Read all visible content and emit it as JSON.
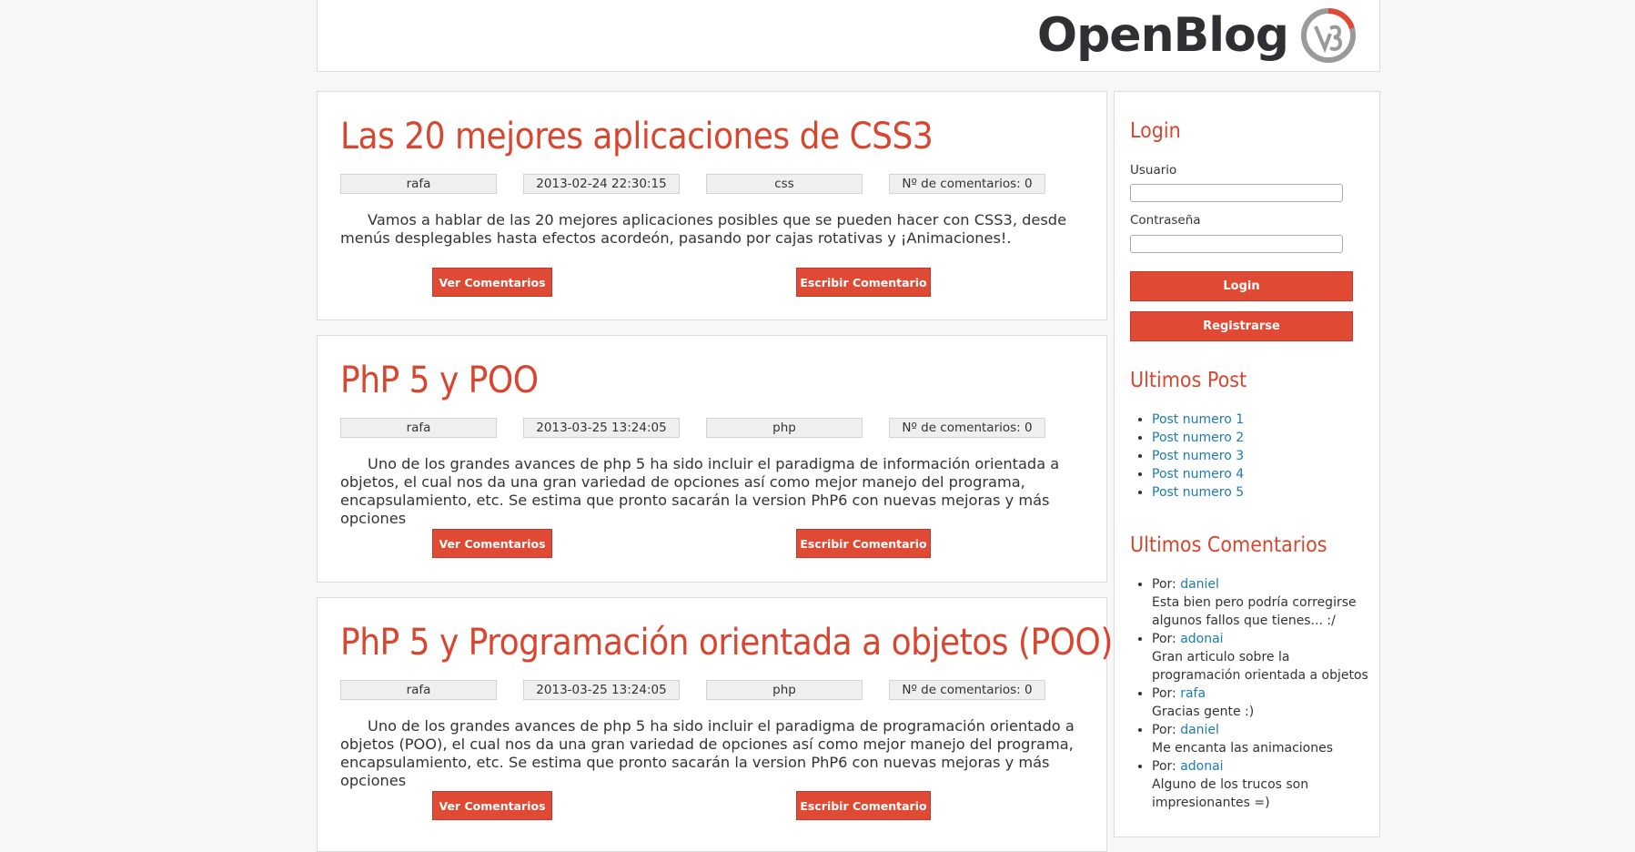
{
  "brand": {
    "name": "OpenBlog",
    "logo_icon": "v3-circle-logo"
  },
  "posts": [
    {
      "title": "Las 20 mejores aplicaciones de CSS3",
      "author": "rafa",
      "date": "2013-02-24 22:30:15",
      "category": "css",
      "comments": "Nº de comentarios: 0",
      "body": "Vamos a hablar de las 20 mejores aplicaciones posibles que se pueden hacer con CSS3, desde menús desplegables hasta efectos acordeón, pasando por cajas rotativas y ¡Animaciones!.",
      "view_label": "Ver Comentarios",
      "write_label": "Escribir Comentario"
    },
    {
      "title": "PhP 5 y POO",
      "author": "rafa",
      "date": "2013-03-25 13:24:05",
      "category": "php",
      "comments": "Nº de comentarios: 0",
      "body": "Uno de los grandes avances de php 5 ha sido incluir el paradigma de información orientada a objetos, el cual nos da una gran variedad de opciones así como mejor manejo del programa, encapsulamiento, etc. Se estima que pronto sacarán la version PhP6 con nuevas mejoras y más opciones",
      "view_label": "Ver Comentarios",
      "write_label": "Escribir Comentario"
    },
    {
      "title": "PhP 5 y Programación orientada a objetos (POO)",
      "author": "rafa",
      "date": "2013-03-25 13:24:05",
      "category": "php",
      "comments": "Nº de comentarios: 0",
      "body": "Uno de los grandes avances de php 5 ha sido incluir el paradigma de programación orientado a objetos (POO), el cual nos da una gran variedad de opciones así como mejor manejo del programa, encapsulamiento, etc. Se estima que pronto sacarán la version PhP6 con nuevas mejoras y más opciones",
      "view_label": "Ver Comentarios",
      "write_label": "Escribir Comentario"
    }
  ],
  "sidebar": {
    "login": {
      "title": "Login",
      "user_label": "Usuario",
      "user_value": "",
      "pass_label": "Contraseña",
      "pass_value": "",
      "login_button": "Login",
      "register_button": "Registrarse"
    },
    "latest_posts": {
      "title": "Ultimos Post",
      "items": [
        "Post numero 1",
        "Post numero 2",
        "Post numero 3",
        "Post numero 4",
        "Post numero 5"
      ]
    },
    "latest_comments": {
      "title": "Ultimos Comentarios",
      "prefix": "Por: ",
      "items": [
        {
          "user": "daniel",
          "text": "Esta bien pero podría corregirse algunos fallos que tienes... :/"
        },
        {
          "user": "adonai",
          "text": "Gran articulo sobre la programación orientada a objetos"
        },
        {
          "user": "rafa",
          "text": "Gracias gente :)"
        },
        {
          "user": "daniel",
          "text": "Me encanta las animaciones"
        },
        {
          "user": "adonai",
          "text": "Alguno de los trucos son impresionantes =)"
        }
      ]
    }
  },
  "colors": {
    "accent": "#d9462f",
    "button": "#e04a34",
    "link": "#1b7bb5"
  }
}
